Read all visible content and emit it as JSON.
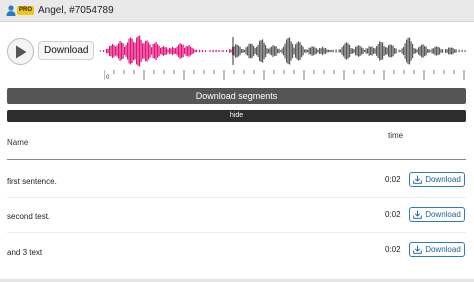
{
  "header": {
    "title": "Angel, #7054789",
    "badge": "PRO",
    "icon": "user-icon"
  },
  "player": {
    "download_label": "Download",
    "ruler_start": "0",
    "played_color": "#e0157c",
    "unplayed_color": "#5a5a5a"
  },
  "actions": {
    "download_segments": "Download segments",
    "hide": "hide"
  },
  "table": {
    "columns": {
      "name": "Name",
      "time": "time"
    },
    "rows": [
      {
        "text": "first sentence.",
        "time": "0:02",
        "action": "Download"
      },
      {
        "text": "second test.",
        "time": "0:02",
        "action": "Download"
      },
      {
        "text": "and 3 text",
        "time": "0:02",
        "action": "Download"
      }
    ]
  },
  "colors": {
    "accent": "#2b7bc4",
    "dark_button": "#555555"
  }
}
